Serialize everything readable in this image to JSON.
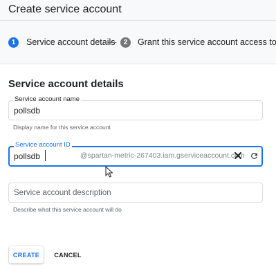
{
  "header": {
    "title": "Create service account"
  },
  "stepper": {
    "steps": [
      {
        "number": "1",
        "label": "Service account details"
      },
      {
        "number": "2",
        "label": "Grant this service account access to the p"
      }
    ],
    "separator": "—"
  },
  "form": {
    "section_title": "Service account details",
    "name": {
      "label": "Service account name",
      "value": "pollsdb",
      "helper": "Display name for this service account"
    },
    "id": {
      "label": "Service account ID",
      "value": "pollsdb",
      "suffix": "@spartan-metric-267403.iam.gserviceaccount.com"
    },
    "description": {
      "placeholder": "Service account description",
      "helper": "Describe what this service account will do"
    }
  },
  "actions": {
    "create_label": "CREATE",
    "cancel_label": "CANCEL"
  },
  "colors": {
    "accent": "#1a73e8",
    "inactive_step": "#757575",
    "border": "#dadce0"
  }
}
